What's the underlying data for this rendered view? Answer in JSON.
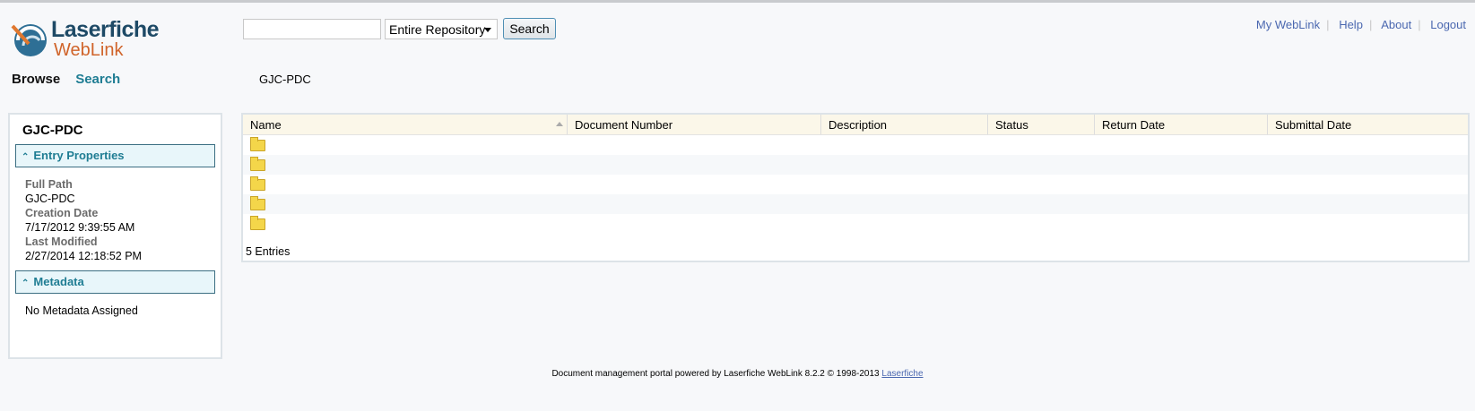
{
  "logo": {
    "name": "Laserfiche",
    "product": "WebLink"
  },
  "search": {
    "value": "",
    "scope": "Entire Repository",
    "button": "Search"
  },
  "toplinks": [
    "My WebLink",
    "Help",
    "About",
    "Logout"
  ],
  "nav": {
    "browse": "Browse",
    "search": "Search"
  },
  "breadcrumb": "GJC-PDC",
  "panel": {
    "title": "GJC-PDC",
    "entry_properties": "Entry Properties",
    "props": [
      {
        "label": "Full Path",
        "value": "GJC-PDC"
      },
      {
        "label": "Creation Date",
        "value": "7/17/2012 9:39:55 AM"
      },
      {
        "label": "Last Modified",
        "value": "2/27/2014 12:18:52 PM"
      }
    ],
    "metadata": "Metadata",
    "metadata_text": "No Metadata Assigned"
  },
  "grid": {
    "columns": [
      "Name",
      "Document Number",
      "Description",
      "Status",
      "Return Date",
      "Submittal Date"
    ],
    "rows": 5,
    "count": "5 Entries"
  },
  "footer": {
    "text": "Document management portal powered by Laserfiche WebLink 8.2.2 © 1998-2013 ",
    "link": "Laserfiche"
  }
}
